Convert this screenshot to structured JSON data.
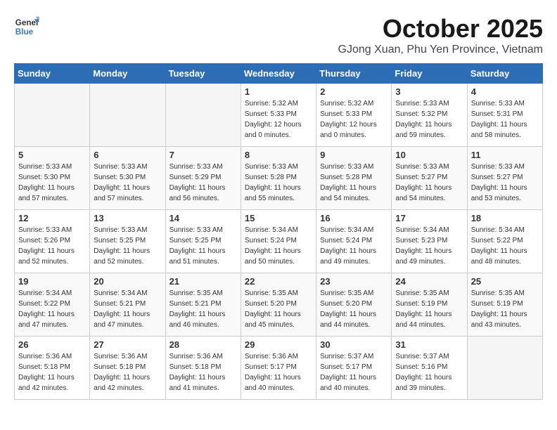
{
  "header": {
    "logo_line1": "General",
    "logo_line2": "Blue",
    "month": "October 2025",
    "location": "GJong Xuan, Phu Yen Province, Vietnam"
  },
  "weekdays": [
    "Sunday",
    "Monday",
    "Tuesday",
    "Wednesday",
    "Thursday",
    "Friday",
    "Saturday"
  ],
  "weeks": [
    [
      {
        "day": "",
        "empty": true
      },
      {
        "day": "",
        "empty": true
      },
      {
        "day": "",
        "empty": true
      },
      {
        "day": "1",
        "sunrise": "5:32 AM",
        "sunset": "5:33 PM",
        "daylight": "12 hours and 0 minutes."
      },
      {
        "day": "2",
        "sunrise": "5:32 AM",
        "sunset": "5:33 PM",
        "daylight": "12 hours and 0 minutes."
      },
      {
        "day": "3",
        "sunrise": "5:33 AM",
        "sunset": "5:32 PM",
        "daylight": "11 hours and 59 minutes."
      },
      {
        "day": "4",
        "sunrise": "5:33 AM",
        "sunset": "5:31 PM",
        "daylight": "11 hours and 58 minutes."
      }
    ],
    [
      {
        "day": "5",
        "sunrise": "5:33 AM",
        "sunset": "5:30 PM",
        "daylight": "11 hours and 57 minutes."
      },
      {
        "day": "6",
        "sunrise": "5:33 AM",
        "sunset": "5:30 PM",
        "daylight": "11 hours and 57 minutes."
      },
      {
        "day": "7",
        "sunrise": "5:33 AM",
        "sunset": "5:29 PM",
        "daylight": "11 hours and 56 minutes."
      },
      {
        "day": "8",
        "sunrise": "5:33 AM",
        "sunset": "5:28 PM",
        "daylight": "11 hours and 55 minutes."
      },
      {
        "day": "9",
        "sunrise": "5:33 AM",
        "sunset": "5:28 PM",
        "daylight": "11 hours and 54 minutes."
      },
      {
        "day": "10",
        "sunrise": "5:33 AM",
        "sunset": "5:27 PM",
        "daylight": "11 hours and 54 minutes."
      },
      {
        "day": "11",
        "sunrise": "5:33 AM",
        "sunset": "5:27 PM",
        "daylight": "11 hours and 53 minutes."
      }
    ],
    [
      {
        "day": "12",
        "sunrise": "5:33 AM",
        "sunset": "5:26 PM",
        "daylight": "11 hours and 52 minutes."
      },
      {
        "day": "13",
        "sunrise": "5:33 AM",
        "sunset": "5:25 PM",
        "daylight": "11 hours and 52 minutes."
      },
      {
        "day": "14",
        "sunrise": "5:33 AM",
        "sunset": "5:25 PM",
        "daylight": "11 hours and 51 minutes."
      },
      {
        "day": "15",
        "sunrise": "5:34 AM",
        "sunset": "5:24 PM",
        "daylight": "11 hours and 50 minutes."
      },
      {
        "day": "16",
        "sunrise": "5:34 AM",
        "sunset": "5:24 PM",
        "daylight": "11 hours and 49 minutes."
      },
      {
        "day": "17",
        "sunrise": "5:34 AM",
        "sunset": "5:23 PM",
        "daylight": "11 hours and 49 minutes."
      },
      {
        "day": "18",
        "sunrise": "5:34 AM",
        "sunset": "5:22 PM",
        "daylight": "11 hours and 48 minutes."
      }
    ],
    [
      {
        "day": "19",
        "sunrise": "5:34 AM",
        "sunset": "5:22 PM",
        "daylight": "11 hours and 47 minutes."
      },
      {
        "day": "20",
        "sunrise": "5:34 AM",
        "sunset": "5:21 PM",
        "daylight": "11 hours and 47 minutes."
      },
      {
        "day": "21",
        "sunrise": "5:35 AM",
        "sunset": "5:21 PM",
        "daylight": "11 hours and 46 minutes."
      },
      {
        "day": "22",
        "sunrise": "5:35 AM",
        "sunset": "5:20 PM",
        "daylight": "11 hours and 45 minutes."
      },
      {
        "day": "23",
        "sunrise": "5:35 AM",
        "sunset": "5:20 PM",
        "daylight": "11 hours and 44 minutes."
      },
      {
        "day": "24",
        "sunrise": "5:35 AM",
        "sunset": "5:19 PM",
        "daylight": "11 hours and 44 minutes."
      },
      {
        "day": "25",
        "sunrise": "5:35 AM",
        "sunset": "5:19 PM",
        "daylight": "11 hours and 43 minutes."
      }
    ],
    [
      {
        "day": "26",
        "sunrise": "5:36 AM",
        "sunset": "5:18 PM",
        "daylight": "11 hours and 42 minutes."
      },
      {
        "day": "27",
        "sunrise": "5:36 AM",
        "sunset": "5:18 PM",
        "daylight": "11 hours and 42 minutes."
      },
      {
        "day": "28",
        "sunrise": "5:36 AM",
        "sunset": "5:18 PM",
        "daylight": "11 hours and 41 minutes."
      },
      {
        "day": "29",
        "sunrise": "5:36 AM",
        "sunset": "5:17 PM",
        "daylight": "11 hours and 40 minutes."
      },
      {
        "day": "30",
        "sunrise": "5:37 AM",
        "sunset": "5:17 PM",
        "daylight": "11 hours and 40 minutes."
      },
      {
        "day": "31",
        "sunrise": "5:37 AM",
        "sunset": "5:16 PM",
        "daylight": "11 hours and 39 minutes."
      },
      {
        "day": "",
        "empty": true
      }
    ]
  ],
  "labels": {
    "sunrise": "Sunrise:",
    "sunset": "Sunset:",
    "daylight": "Daylight:"
  }
}
